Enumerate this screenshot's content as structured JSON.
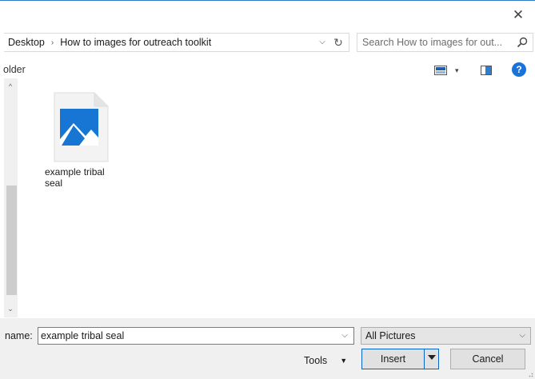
{
  "window": {
    "close_glyph": "✕"
  },
  "address_bar": {
    "breadcrumbs": [
      {
        "label": "Desktop"
      },
      {
        "label": "How to images for outreach toolkit"
      }
    ],
    "separator": "›",
    "dropdown_glyph": "⌵",
    "refresh_glyph": "↻"
  },
  "search": {
    "placeholder": "Search How to images for out..."
  },
  "command_bar": {
    "new_folder_label": "older",
    "view_dropdown_glyph": "▾",
    "help_glyph": "?"
  },
  "scrollbar": {
    "up_glyph": "^",
    "down_glyph": "⌄"
  },
  "files": [
    {
      "name": "example tribal seal",
      "icon": "image-file-icon"
    }
  ],
  "bottom": {
    "file_name_label": "name:",
    "file_name_value": "example tribal seal",
    "file_name_dropdown_glyph": "⌵",
    "filter_value": "All Pictures",
    "filter_dropdown_glyph": "⌵",
    "tools_label": "Tools",
    "tools_dropdown_glyph": "▼",
    "insert_label": "Insert",
    "cancel_label": "Cancel"
  },
  "colors": {
    "accent": "#0a64c8",
    "help": "#1a73d8",
    "image_blue": "#1776d4",
    "panel_bg": "#f0f0f0"
  }
}
